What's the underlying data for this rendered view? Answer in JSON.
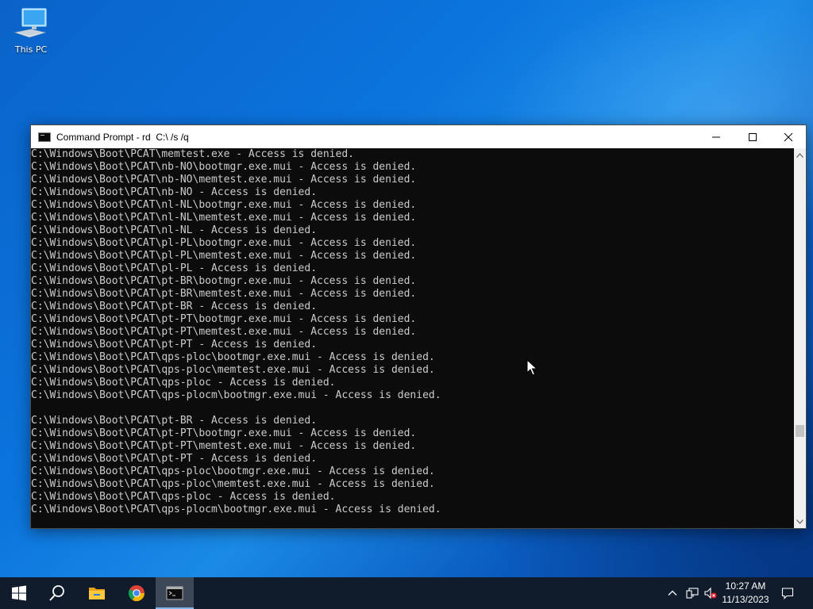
{
  "desktop": {
    "icons": [
      {
        "label": "This PC",
        "icon": "computer-icon"
      }
    ]
  },
  "window": {
    "title": "Command Prompt - rd  C:\\ /s /q",
    "controls": {
      "minimize": "minimize-icon",
      "maximize": "maximize-icon",
      "close": "close-icon"
    },
    "background": "#0c0c0c",
    "text_color": "#cccccc"
  },
  "console": {
    "lines": [
      "C:\\Windows\\Boot\\PCAT\\memtest.exe - Access is denied.",
      "C:\\Windows\\Boot\\PCAT\\nb-NO\\bootmgr.exe.mui - Access is denied.",
      "C:\\Windows\\Boot\\PCAT\\nb-NO\\memtest.exe.mui - Access is denied.",
      "C:\\Windows\\Boot\\PCAT\\nb-NO - Access is denied.",
      "C:\\Windows\\Boot\\PCAT\\nl-NL\\bootmgr.exe.mui - Access is denied.",
      "C:\\Windows\\Boot\\PCAT\\nl-NL\\memtest.exe.mui - Access is denied.",
      "C:\\Windows\\Boot\\PCAT\\nl-NL - Access is denied.",
      "C:\\Windows\\Boot\\PCAT\\pl-PL\\bootmgr.exe.mui - Access is denied.",
      "C:\\Windows\\Boot\\PCAT\\pl-PL\\memtest.exe.mui - Access is denied.",
      "C:\\Windows\\Boot\\PCAT\\pl-PL - Access is denied.",
      "C:\\Windows\\Boot\\PCAT\\pt-BR\\bootmgr.exe.mui - Access is denied.",
      "C:\\Windows\\Boot\\PCAT\\pt-BR\\memtest.exe.mui - Access is denied.",
      "C:\\Windows\\Boot\\PCAT\\pt-BR - Access is denied.",
      "C:\\Windows\\Boot\\PCAT\\pt-PT\\bootmgr.exe.mui - Access is denied.",
      "C:\\Windows\\Boot\\PCAT\\pt-PT\\memtest.exe.mui - Access is denied.",
      "C:\\Windows\\Boot\\PCAT\\pt-PT - Access is denied.",
      "C:\\Windows\\Boot\\PCAT\\qps-ploc\\bootmgr.exe.mui - Access is denied.",
      "C:\\Windows\\Boot\\PCAT\\qps-ploc\\memtest.exe.mui - Access is denied.",
      "C:\\Windows\\Boot\\PCAT\\qps-ploc - Access is denied.",
      "C:\\Windows\\Boot\\PCAT\\qps-plocm\\bootmgr.exe.mui - Access is denied.",
      "",
      "C:\\Windows\\Boot\\PCAT\\pt-BR - Access is denied.",
      "C:\\Windows\\Boot\\PCAT\\pt-PT\\bootmgr.exe.mui - Access is denied.",
      "C:\\Windows\\Boot\\PCAT\\pt-PT\\memtest.exe.mui - Access is denied.",
      "C:\\Windows\\Boot\\PCAT\\pt-PT - Access is denied.",
      "C:\\Windows\\Boot\\PCAT\\qps-ploc\\bootmgr.exe.mui - Access is denied.",
      "C:\\Windows\\Boot\\PCAT\\qps-ploc\\memtest.exe.mui - Access is denied.",
      "C:\\Windows\\Boot\\PCAT\\qps-ploc - Access is denied.",
      "C:\\Windows\\Boot\\PCAT\\qps-plocm\\bootmgr.exe.mui - Access is denied."
    ]
  },
  "taskbar": {
    "items": [
      {
        "name": "start",
        "icon": "windows-logo-icon"
      },
      {
        "name": "search",
        "icon": "search-icon"
      },
      {
        "name": "file-explorer",
        "icon": "folder-icon"
      },
      {
        "name": "chrome",
        "icon": "chrome-icon"
      },
      {
        "name": "command-prompt",
        "icon": "cmd-icon",
        "active": true
      }
    ],
    "tray": {
      "icons": [
        "chevron-up-icon",
        "network-icon",
        "volume-muted-icon",
        "notification-icon"
      ],
      "time": "10:27 AM",
      "date": "11/13/2023"
    },
    "background": "#101c2c",
    "accent": "#7fb4ea"
  }
}
